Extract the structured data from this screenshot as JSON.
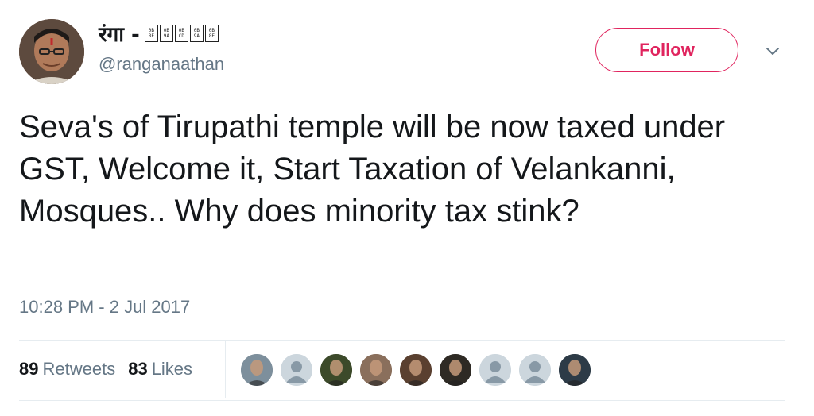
{
  "author": {
    "display_name": "रंगा -",
    "name_glyph_placeholders": [
      "0B 8E",
      "0B 9A",
      "0B CD",
      "0B 9A",
      "0B 8E"
    ],
    "handle": "@ranganaathan",
    "avatar_icon": "profile-photo"
  },
  "actions": {
    "follow_label": "Follow",
    "more_icon": "chevron-down-icon"
  },
  "tweet": {
    "text": "Seva's of Tirupathi temple will be now taxed under GST, Welcome it, Start Taxation of Velankanni, Mosques.. Why does minority tax stink?",
    "timestamp": "10:28 PM - 2 Jul 2017"
  },
  "stats": {
    "retweets_count": "89",
    "retweets_label": "Retweets",
    "likes_count": "83",
    "likes_label": "Likes"
  },
  "likers": [
    {
      "kind": "photo",
      "bg": "#7d8f9c"
    },
    {
      "kind": "default",
      "bg": "#ccd6dd"
    },
    {
      "kind": "photo",
      "bg": "#3c4a2a"
    },
    {
      "kind": "photo",
      "bg": "#8a6f5c"
    },
    {
      "kind": "photo",
      "bg": "#5a4030"
    },
    {
      "kind": "photo",
      "bg": "#2e2a24"
    },
    {
      "kind": "default",
      "bg": "#ccd6dd"
    },
    {
      "kind": "default",
      "bg": "#ccd6dd"
    },
    {
      "kind": "photo",
      "bg": "#2d3b47"
    }
  ],
  "colors": {
    "follow_accent": "#e0245e",
    "secondary_text": "#657786",
    "primary_text": "#14171a",
    "divider": "#e6ecf0"
  }
}
